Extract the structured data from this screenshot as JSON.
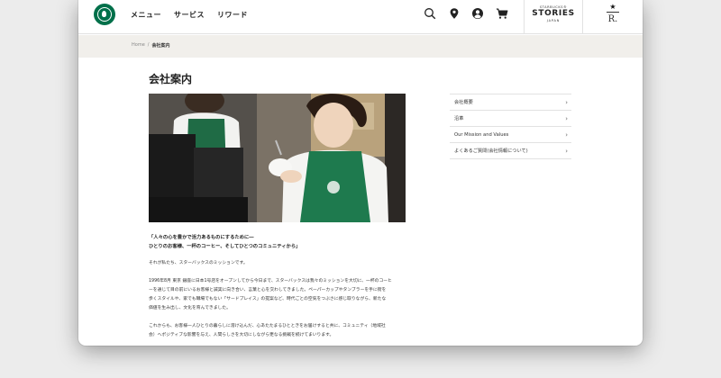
{
  "header": {
    "nav": [
      "メニュー",
      "サービス",
      "リワード"
    ],
    "icons": [
      "search-icon",
      "location-pin-icon",
      "account-icon",
      "cart-icon"
    ],
    "stories": {
      "top": "STARBUCKS®",
      "main": "STORIES",
      "sub": "JAPAN"
    },
    "reserve": {
      "mark": "R."
    }
  },
  "breadcrumb": {
    "home": "Home",
    "separator": "/",
    "current": "会社案内"
  },
  "page": {
    "title": "会社案内",
    "lede": [
      "「人々の心を豊かで活力あるものにするために―",
      "ひとりのお客様、一杯のコーヒー、そしてひとつのコミュニティから」"
    ],
    "para1": "それが私たち、スターバックスのミッションです。",
    "para2": [
      "1996年8月 東京 銀座に日本1号店をオープンしてから今日まで、スターバックスは我々のミッションを大切に、一杯のコーヒ",
      "ーを通じて目の前にいるお客様と誠実に向き合い、言葉と心を交わしてきました。ペーパーカップやタンブラーを手に街を",
      "歩くスタイルや、家でも職場でもない「サードプレイス」の提案など、時代ごとの空気をつぶさに感じ取りながら、新たな",
      "価値を生み出し、文化を育んできました。"
    ],
    "para3": [
      "これからも、お客様一人ひとりの暮らしに溶け込んだ、心あたたまるひとときをお届けすると共に、コミュニティ（地域社",
      "会）へポジティブな影響を与え、人間らしさを大切にしながら更なる挑戦を続けてまいります。"
    ]
  },
  "sidebar": {
    "items": [
      "会社概要",
      "沿革",
      "Our Mission and Values",
      "よくあるご質問(会社情報について)"
    ]
  },
  "colors": {
    "brand_green": "#00704a",
    "crumb_bg": "#f1efeb"
  }
}
